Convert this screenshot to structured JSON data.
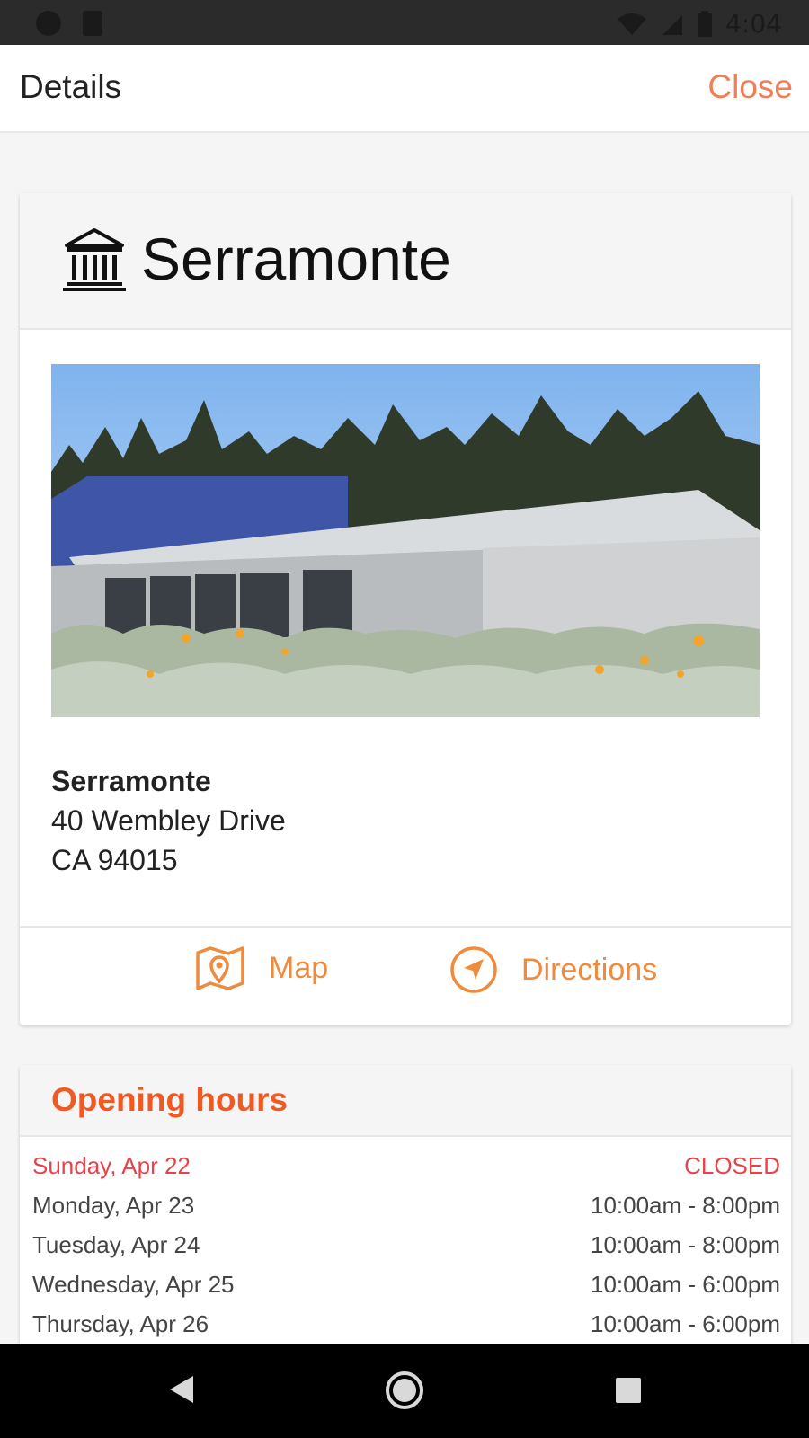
{
  "status_bar": {
    "time": "4:04"
  },
  "app_bar": {
    "title": "Details",
    "close_label": "Close"
  },
  "location": {
    "name": "Serramonte",
    "address_name": "Serramonte",
    "address_line1": "40 Wembley Drive",
    "address_line2": "CA 94015",
    "icon": "bank-icon"
  },
  "actions": {
    "map_label": "Map",
    "directions_label": "Directions"
  },
  "hours": {
    "title": "Opening hours",
    "rows": [
      {
        "day": "Sunday, Apr 22",
        "time": "CLOSED",
        "today": true
      },
      {
        "day": "Monday, Apr 23",
        "time": "10:00am - 8:00pm"
      },
      {
        "day": "Tuesday, Apr 24",
        "time": "10:00am - 8:00pm"
      },
      {
        "day": "Wednesday, Apr 25",
        "time": "10:00am - 6:00pm"
      },
      {
        "day": "Thursday, Apr 26",
        "time": "10:00am - 6:00pm"
      }
    ]
  },
  "colors": {
    "accent": "#f07f57",
    "hours_title": "#f05a22",
    "closed_red": "#e8424a",
    "action_orange": "#f08a3c"
  }
}
